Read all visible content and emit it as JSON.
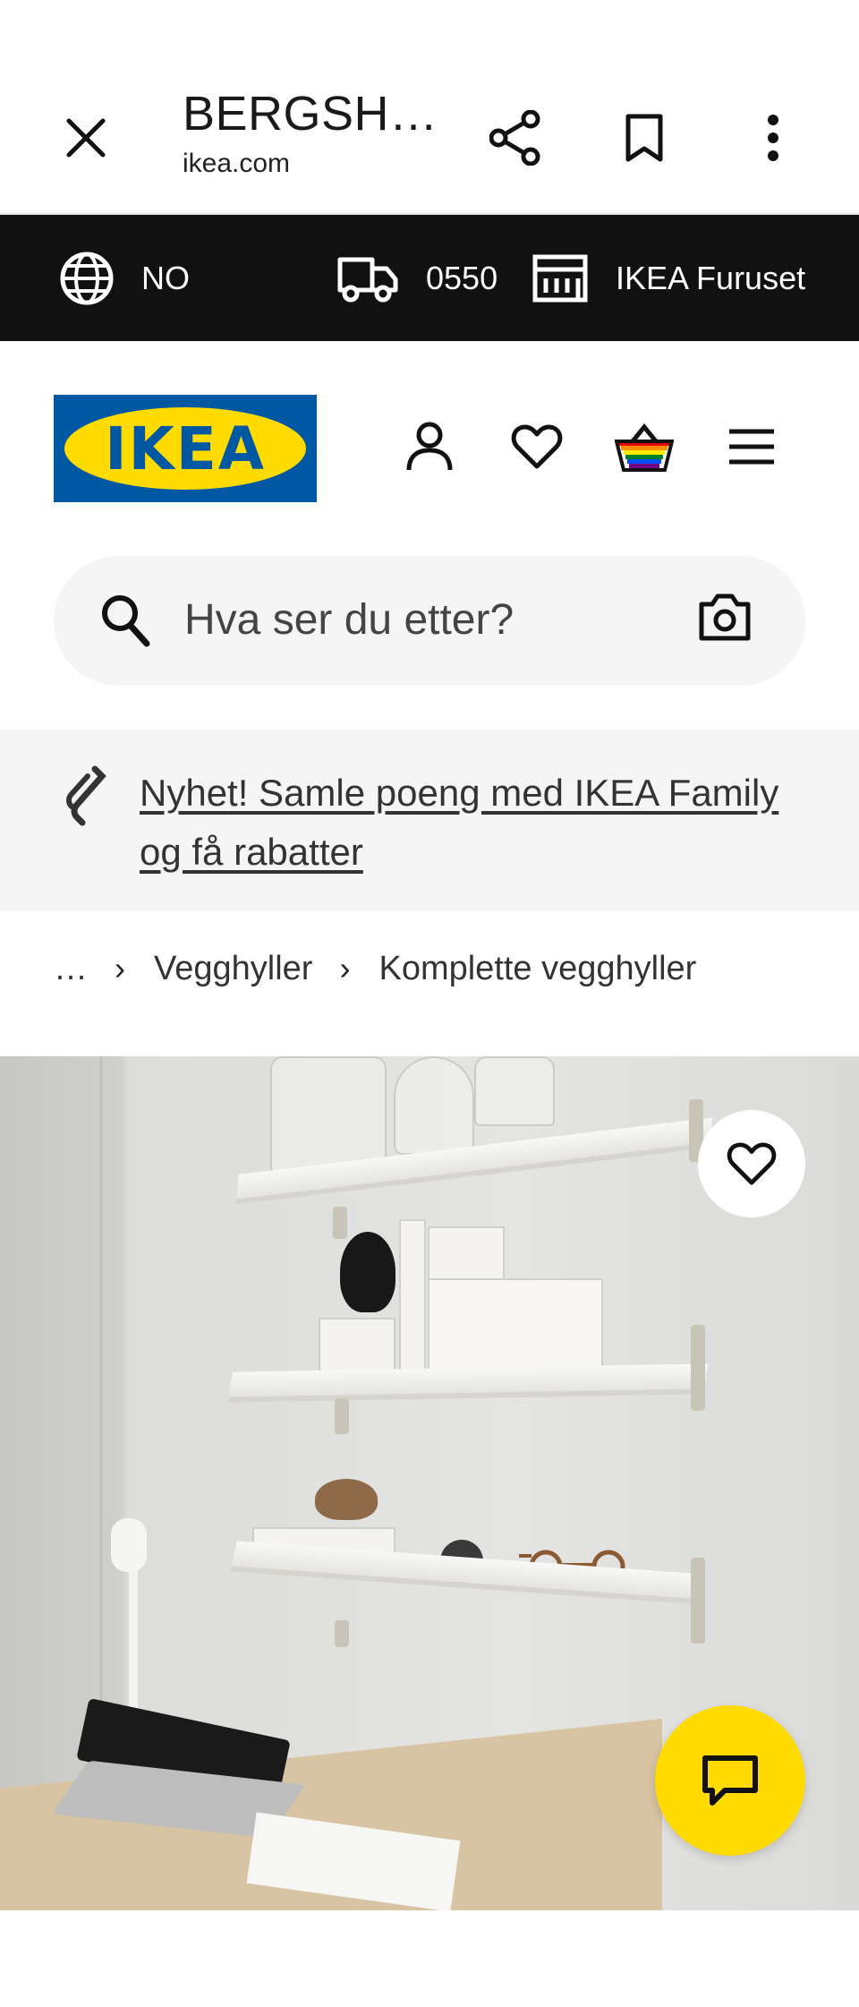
{
  "browser": {
    "title": "BERGSH…",
    "domain": "ikea.com"
  },
  "utility_bar": {
    "country": "NO",
    "postcode": "0550",
    "store": "IKEA Furuset"
  },
  "header": {
    "logo_text": "IKEA"
  },
  "search": {
    "placeholder": "Hva ser du etter?"
  },
  "promo": {
    "text": "Nyhet! Samle poeng med IKEA Family og få rabatter"
  },
  "breadcrumb": {
    "items": [
      "…",
      "Vegghyller",
      "Komplette vegghyller"
    ]
  },
  "colors": {
    "brand_blue": "#0058a3",
    "brand_yellow": "#ffdb00",
    "utility_bg": "#111111"
  },
  "icons": {
    "close": "close-icon",
    "share": "share-icon",
    "bookmark": "bookmark-icon",
    "more": "more-vertical-icon",
    "globe": "globe-icon",
    "truck": "truck-icon",
    "store": "store-icon",
    "account": "person-icon",
    "wishlist": "heart-icon",
    "cart": "basket-icon",
    "menu": "hamburger-menu-icon",
    "search": "search-icon",
    "camera": "camera-icon",
    "family": "ikea-family-icon",
    "chat": "chat-icon"
  }
}
